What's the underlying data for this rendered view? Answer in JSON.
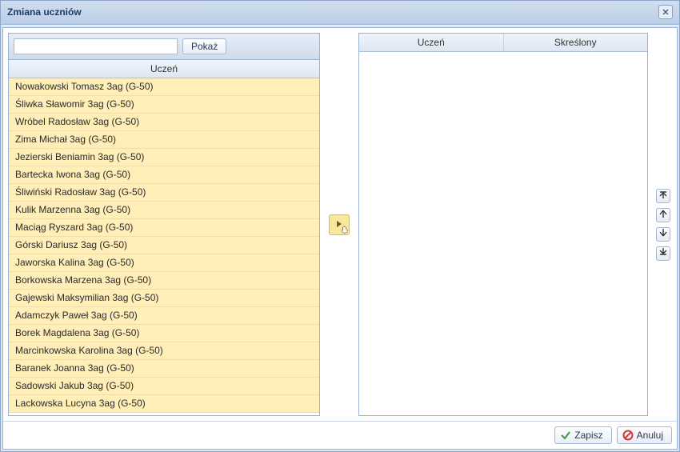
{
  "window": {
    "title": "Zmiana uczniów"
  },
  "left": {
    "show_button": "Pokaż",
    "search_value": "",
    "header": "Uczeń",
    "rows": [
      "Nowakowski Tomasz 3ag (G-50)",
      "Śliwka Sławomir 3ag (G-50)",
      "Wróbel Radosław 3ag (G-50)",
      "Zima Michał 3ag (G-50)",
      "Jezierski Beniamin 3ag (G-50)",
      "Bartecka Iwona 3ag (G-50)",
      "Śliwiński Radosław 3ag (G-50)",
      "Kulik Marzenna 3ag (G-50)",
      "Maciąg Ryszard 3ag (G-50)",
      "Górski Dariusz 3ag (G-50)",
      "Jaworska Kalina 3ag (G-50)",
      "Borkowska Marzena 3ag (G-50)",
      "Gajewski Maksymilian 3ag (G-50)",
      "Adamczyk Paweł 3ag (G-50)",
      "Borek Magdalena 3ag (G-50)",
      "Marcinkowska Karolina 3ag (G-50)",
      "Baranek Joanna 3ag (G-50)",
      "Sadowski Jakub 3ag (G-50)",
      "Lackowska Lucyna 3ag (G-50)"
    ]
  },
  "right": {
    "headers": [
      "Uczeń",
      "Skreślony"
    ]
  },
  "footer": {
    "save": "Zapisz",
    "cancel": "Anuluj"
  }
}
